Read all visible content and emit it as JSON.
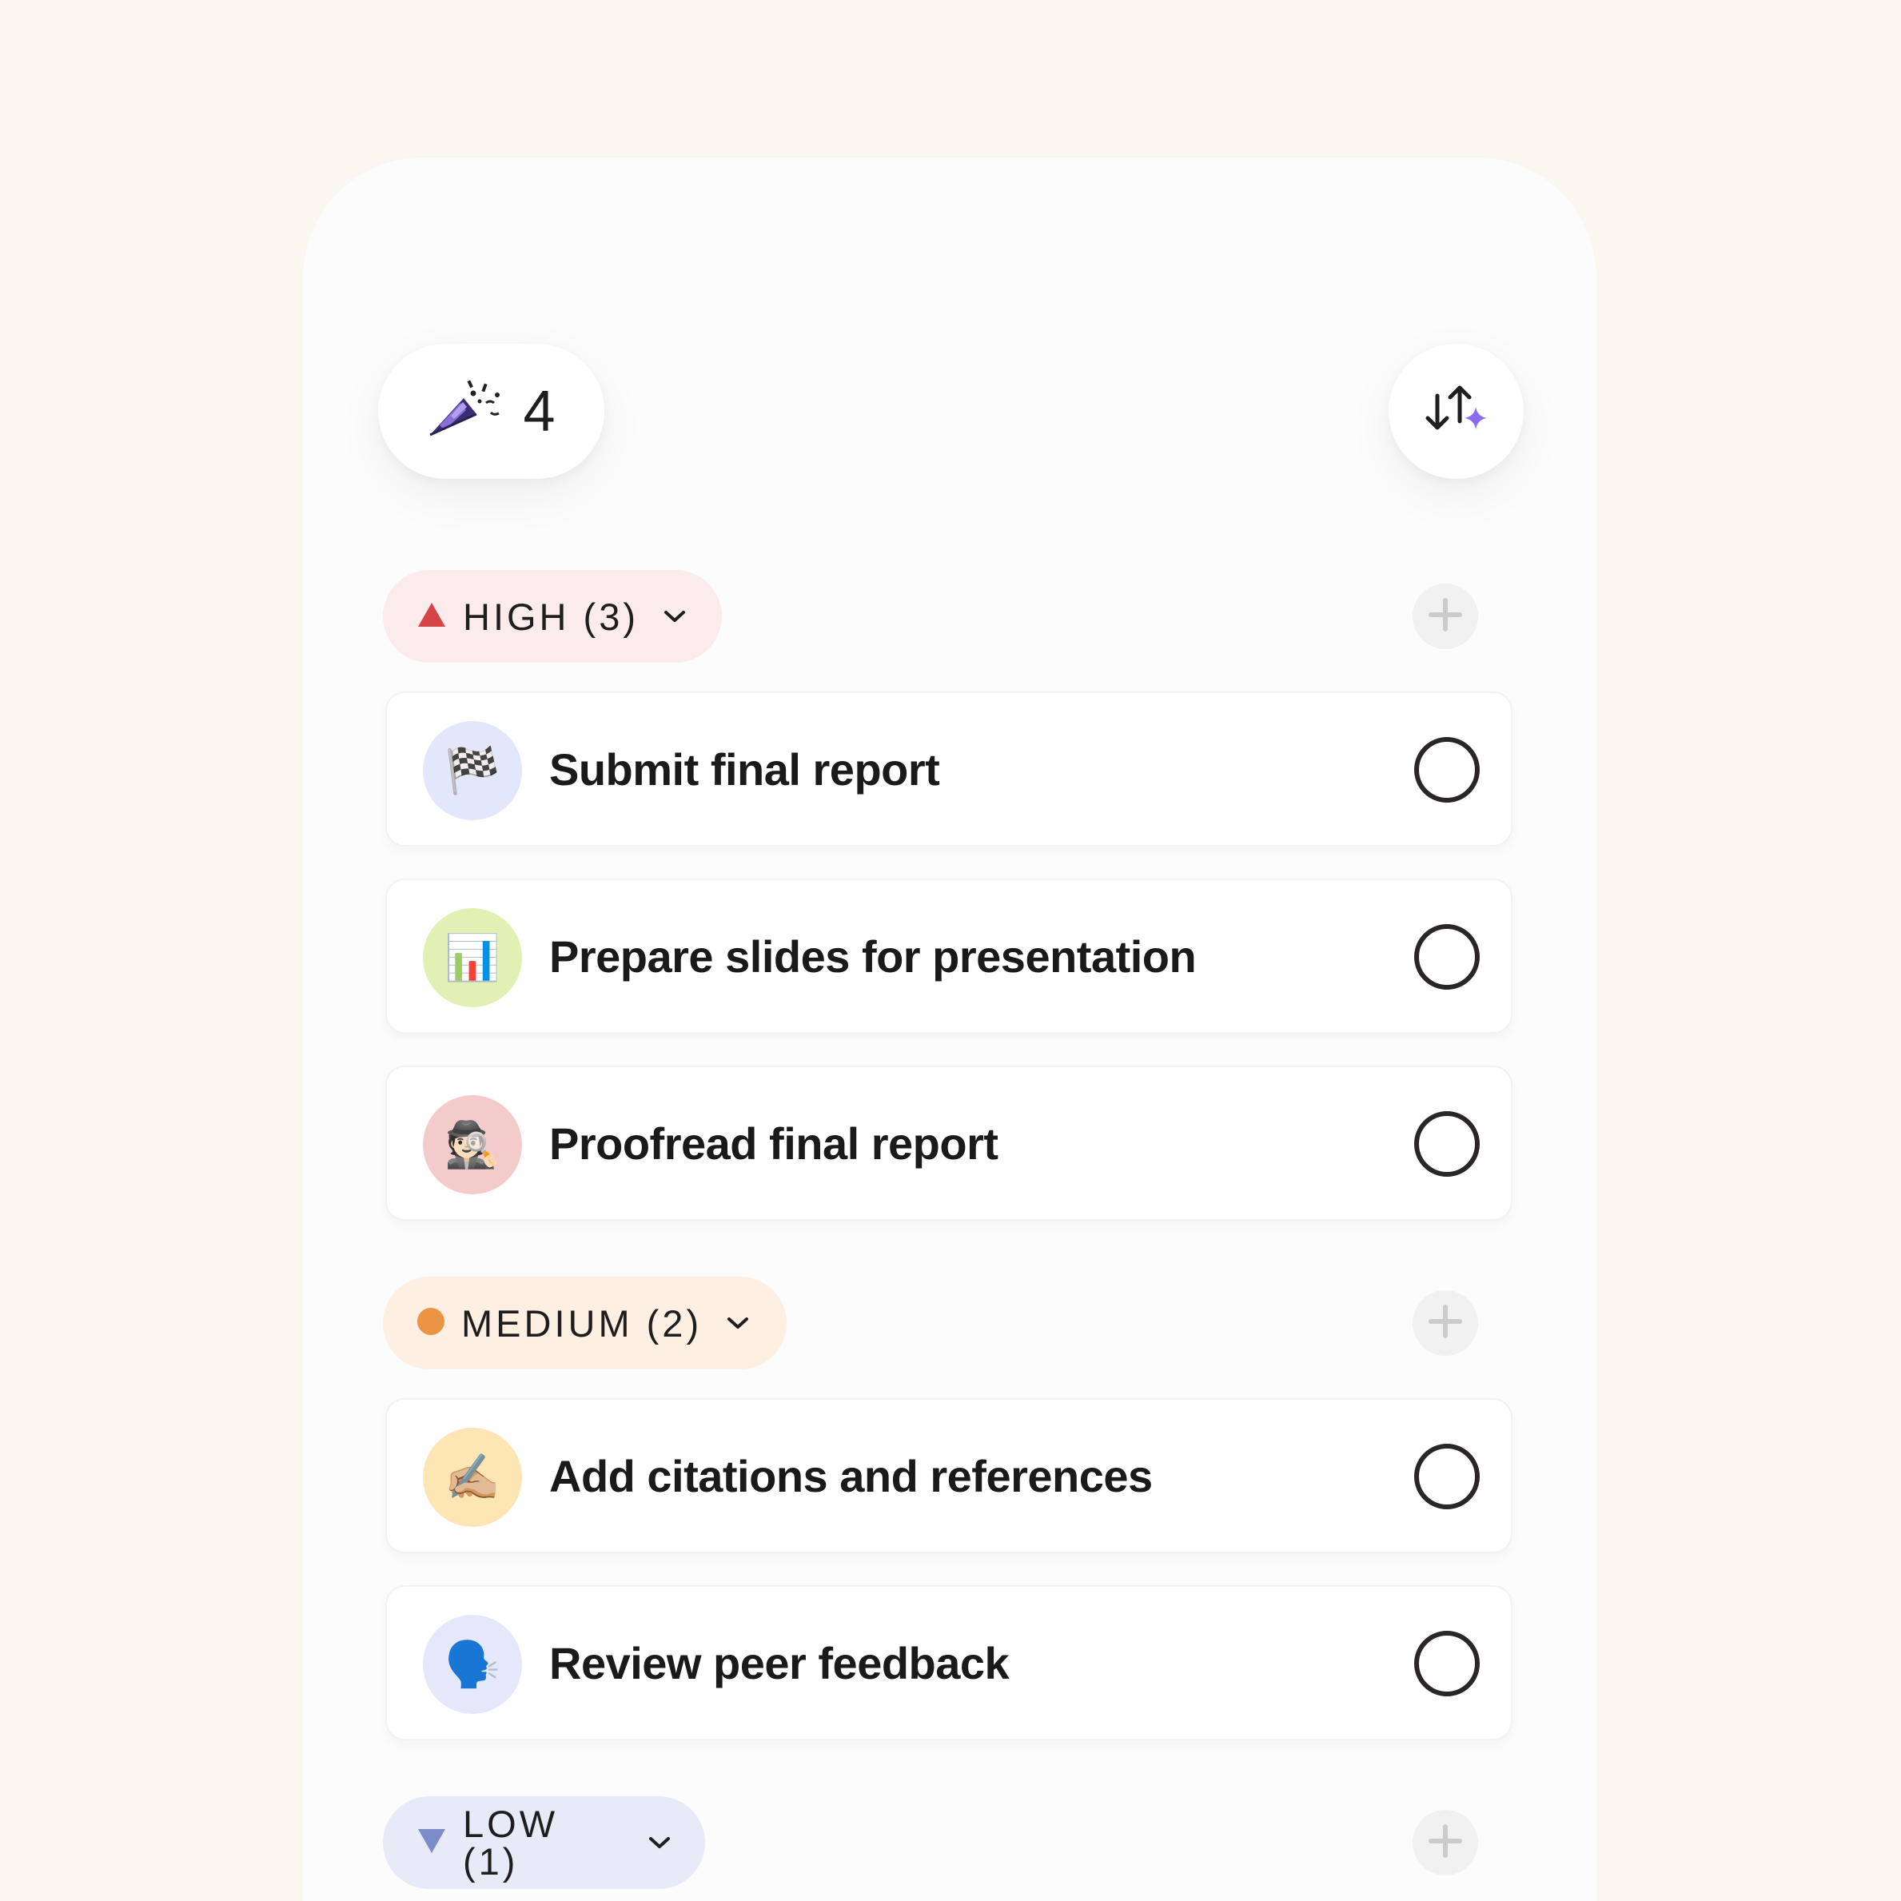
{
  "header": {
    "streak_count": "4",
    "streak_icon": "party-popper-icon",
    "sort_icon": "sparkle-sort-icon"
  },
  "sections": [
    {
      "title": "HIGH (3)",
      "marker": "triangle-up",
      "marker_color": "#d64545",
      "bg_color": "#fbeceb",
      "tasks": [
        {
          "label": "Submit final report",
          "emoji": "🏁",
          "avatar_color": "#e2e7fb"
        },
        {
          "label": "Prepare slides for presentation",
          "emoji": "📊",
          "avatar_color": "#e3f0b4"
        },
        {
          "label": "Proofread final report",
          "emoji": "🕵🏻",
          "avatar_color": "#f4cbcb"
        }
      ]
    },
    {
      "title": "MEDIUM (2)",
      "marker": "circle",
      "marker_color": "#eb9544",
      "bg_color": "#fdefe2",
      "tasks": [
        {
          "label": "Add citations and references",
          "emoji": "✍🏼",
          "avatar_color": "#fde6b4"
        },
        {
          "label": "Review peer feedback",
          "emoji": "🗣️",
          "avatar_color": "#e4e8fa"
        }
      ]
    },
    {
      "title": "LOW (1)",
      "marker": "triangle-down",
      "marker_color": "#7b8cc9",
      "bg_color": "#e7ebf7",
      "tasks": []
    }
  ]
}
